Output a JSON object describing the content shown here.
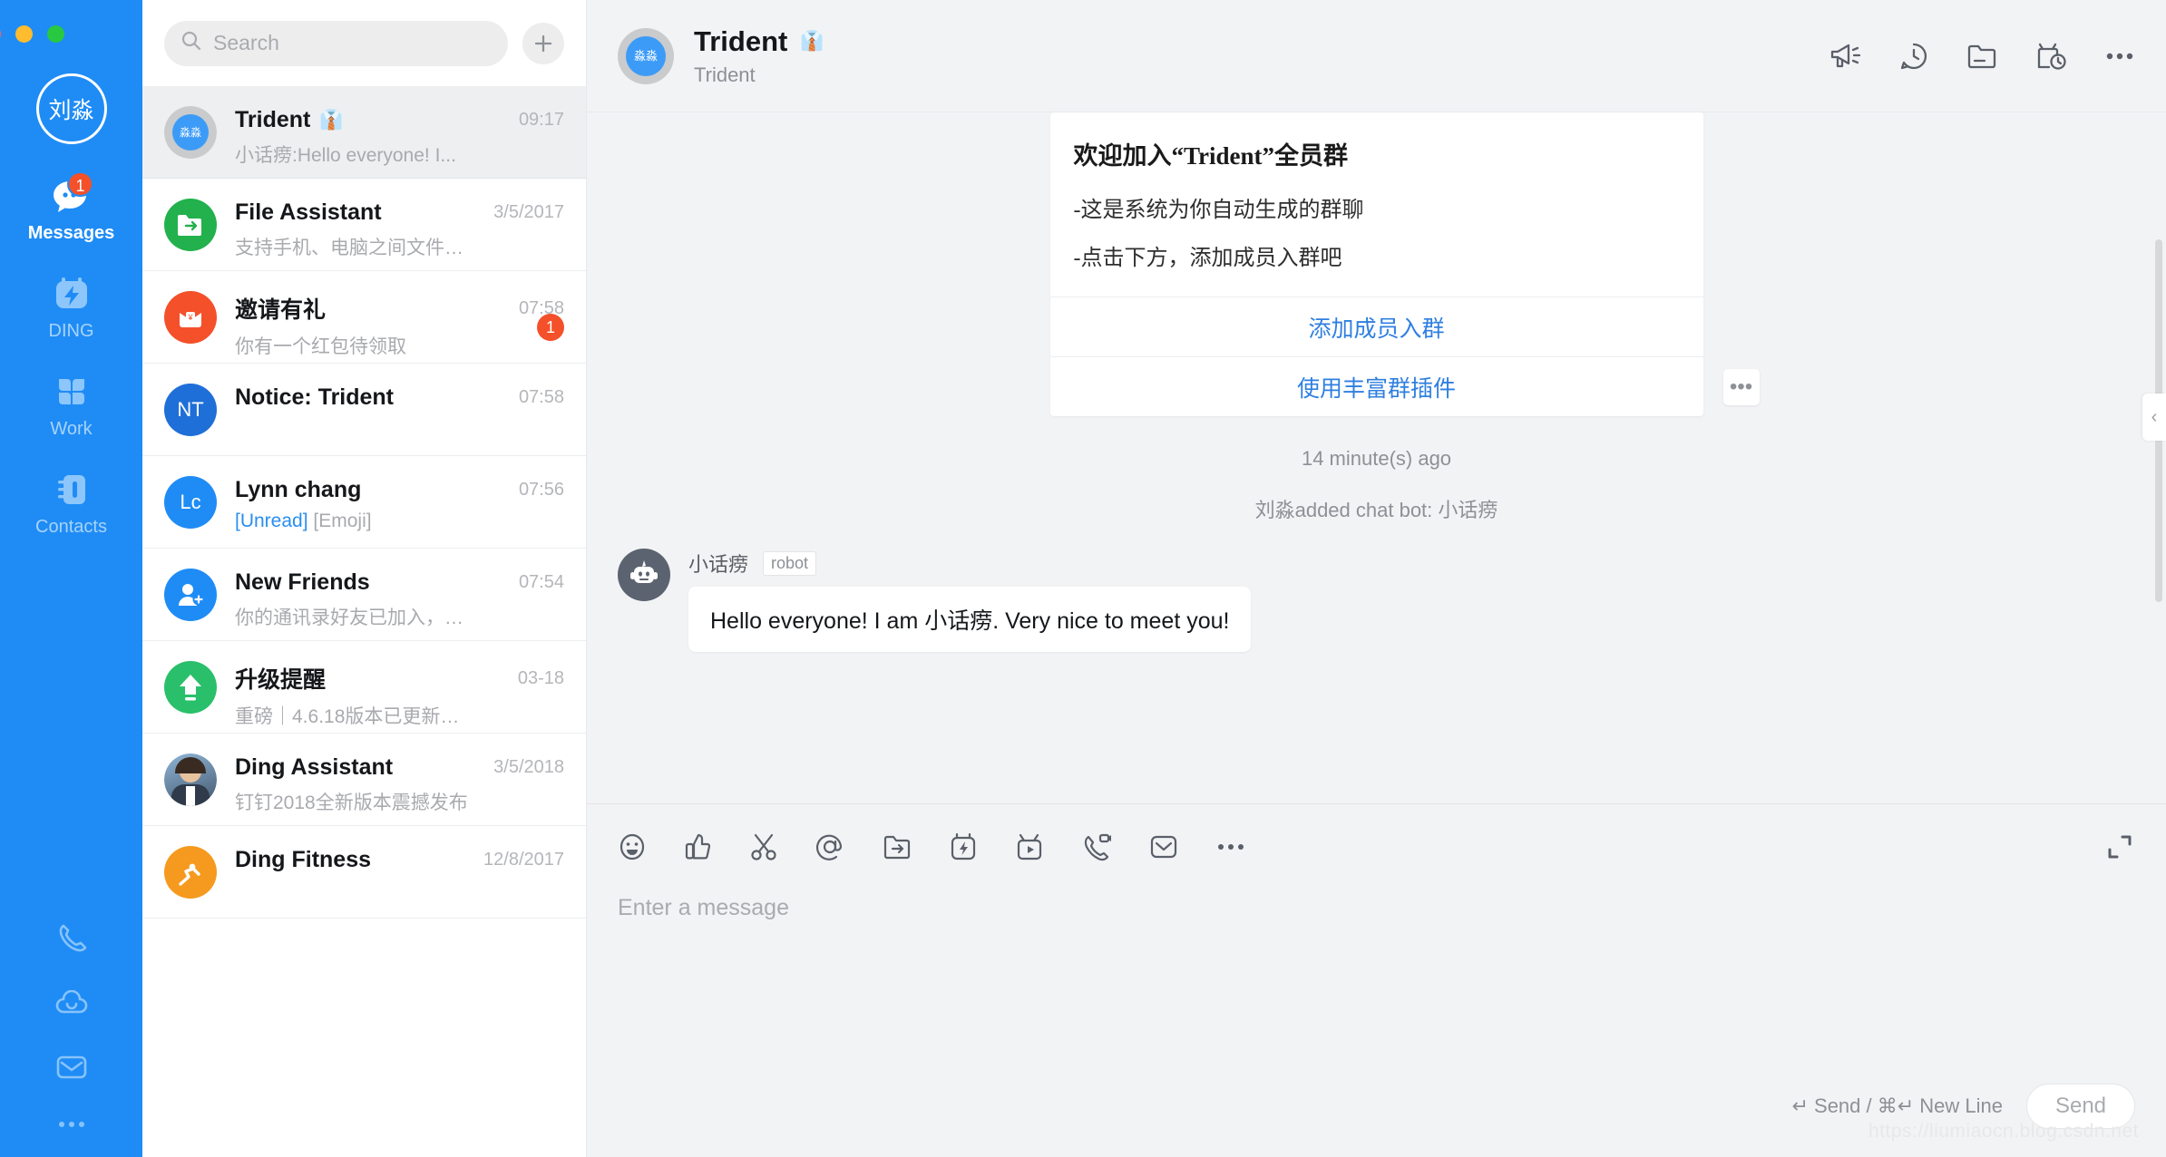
{
  "window": {
    "traffic_lights": [
      "close",
      "minimize",
      "zoom"
    ]
  },
  "rail": {
    "avatar_initials": "刘淼",
    "nav": [
      {
        "label": "Messages",
        "icon": "messages-icon",
        "badge": "1",
        "active": true
      },
      {
        "label": "DING",
        "icon": "ding-icon",
        "badge": "",
        "active": false
      },
      {
        "label": "Work",
        "icon": "work-icon",
        "badge": "",
        "active": false
      },
      {
        "label": "Contacts",
        "icon": "contacts-icon",
        "badge": "",
        "active": false
      }
    ],
    "bottom_icons": [
      "phone-icon",
      "cloud-icon",
      "mail-icon",
      "more-icon"
    ]
  },
  "search": {
    "placeholder": "Search",
    "icon": "search-icon",
    "add_label": "+"
  },
  "chats": [
    {
      "name": "Trident",
      "tie": "👔",
      "time": "09:17",
      "preview": "小话痨:Hello everyone! I...",
      "preview_unread": "",
      "avatar_type": "ring",
      "avatar_text": "淼淼",
      "avatar_color": "#3d9bf8",
      "badge": "",
      "selected": true
    },
    {
      "name": "File Assistant",
      "tie": "",
      "time": "3/5/2017",
      "preview": "支持手机、电脑之间文件…",
      "preview_unread": "",
      "avatar_type": "folder",
      "avatar_text": "",
      "avatar_color": "#22b14c",
      "badge": "",
      "selected": false
    },
    {
      "name": "邀请有礼",
      "tie": "",
      "time": "07:58",
      "preview": "你有一个红包待领取",
      "preview_unread": "",
      "avatar_type": "redpacket",
      "avatar_text": "",
      "avatar_color": "#f4502a",
      "badge": "1",
      "selected": false
    },
    {
      "name": "Notice: Trident",
      "tie": "",
      "time": "07:58",
      "preview": "",
      "preview_unread": "",
      "avatar_type": "initials",
      "avatar_text": "NT",
      "avatar_color": "#1f6fd8",
      "badge": "",
      "selected": false
    },
    {
      "name": "Lynn chang",
      "tie": "",
      "time": "07:56",
      "preview": "[Emoji]",
      "preview_unread": "[Unread]",
      "avatar_type": "initials",
      "avatar_text": "Lc",
      "avatar_color": "#1f8cf5",
      "badge": "",
      "selected": false
    },
    {
      "name": "New Friends",
      "tie": "",
      "time": "07:54",
      "preview": "你的通讯录好友已加入，…",
      "preview_unread": "",
      "avatar_type": "adduser",
      "avatar_text": "",
      "avatar_color": "#1f8cf5",
      "badge": "",
      "selected": false
    },
    {
      "name": "升级提醒",
      "tie": "",
      "time": "03-18",
      "preview": "重磅｜4.6.18版本已更新…",
      "preview_unread": "",
      "avatar_type": "upgrade",
      "avatar_text": "",
      "avatar_color": "#2ac06b",
      "badge": "",
      "selected": false
    },
    {
      "name": "Ding Assistant",
      "tie": "",
      "time": "3/5/2018",
      "preview": "钉钉2018全新版本震撼发布",
      "preview_unread": "",
      "avatar_type": "photo",
      "avatar_text": "",
      "avatar_color": "#5d7fa6",
      "badge": "",
      "selected": false
    },
    {
      "name": "Ding Fitness",
      "tie": "",
      "time": "12/8/2017",
      "preview": "",
      "preview_unread": "",
      "avatar_type": "fitness",
      "avatar_text": "",
      "avatar_color": "#f59a1e",
      "badge": "",
      "selected": false
    }
  ],
  "chat_header": {
    "avatar_text": "淼淼",
    "title": "Trident",
    "tie": "👔",
    "subtitle": "Trident",
    "actions": [
      "announcement-icon",
      "chat-history-icon",
      "folder-icon",
      "live-timer-icon",
      "more-icon"
    ]
  },
  "conversation": {
    "notice_card": {
      "title": "欢迎加入“Trident”全员群",
      "lines": [
        "-这是系统为你自动生成的群聊",
        "-点击下方，添加成员入群吧"
      ],
      "actions": [
        "添加成员入群",
        "使用丰富群插件"
      ],
      "more_label": "•••"
    },
    "timestamp": "14 minute(s) ago",
    "system_event": "刘淼added chat bot: 小话痨",
    "bot_message": {
      "sender": "小话痨",
      "tag": "robot",
      "text": "Hello everyone! I am 小话痨. Very nice to meet you!"
    },
    "collapse_label": "‹"
  },
  "composer": {
    "tools": [
      "emoji-icon",
      "thumbs-up-icon",
      "scissors-icon",
      "mention-icon",
      "file-send-icon",
      "ding-icon",
      "live-video-icon",
      "video-call-icon",
      "mail-icon",
      "more-icon"
    ],
    "expand_icon": "expand-icon",
    "placeholder": "Enter a message",
    "hint": "↵ Send / ⌘↵ New Line",
    "send_label": "Send"
  },
  "watermark": "https://liumiaocn.blog.csdn.net",
  "colors": {
    "brand_blue": "#1f8cf5",
    "accent_red": "#f4502a",
    "link_blue": "#2f7fe0",
    "panel_bg": "#f2f3f5"
  }
}
